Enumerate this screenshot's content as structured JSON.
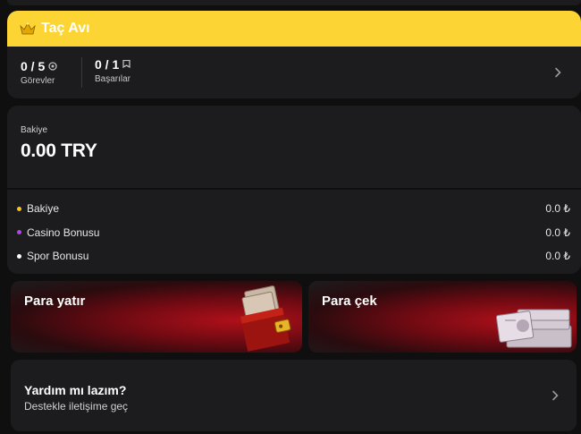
{
  "quest": {
    "title": "Taç Avı",
    "tasks_value": "0 / 5",
    "tasks_label": "Görevler",
    "achievements_value": "0 / 1",
    "achievements_label": "Başarılar",
    "accent": "#fcd535"
  },
  "balance": {
    "label": "Bakiye",
    "amount": "0.00 TRY",
    "rows": [
      {
        "label": "Bakiye",
        "value": "0.0 ₺",
        "dot_color": "#f5c518"
      },
      {
        "label": "Casino Bonusu",
        "value": "0.0 ₺",
        "dot_color": "#b146e6"
      },
      {
        "label": "Spor Bonusu",
        "value": "0.0 ₺",
        "dot_color": "#ffffff"
      }
    ]
  },
  "actions": {
    "deposit_label": "Para yatır",
    "withdraw_label": "Para çek"
  },
  "help": {
    "title": "Yardım mı lazım?",
    "subtitle": "Destekle iletişime geç"
  },
  "icons": {
    "crown": "crown-icon",
    "target": "target-icon",
    "flag": "flag-icon",
    "chevron": "chevron-right-icon",
    "wallet": "wallet-icon",
    "cash": "cash-stack-icon"
  }
}
